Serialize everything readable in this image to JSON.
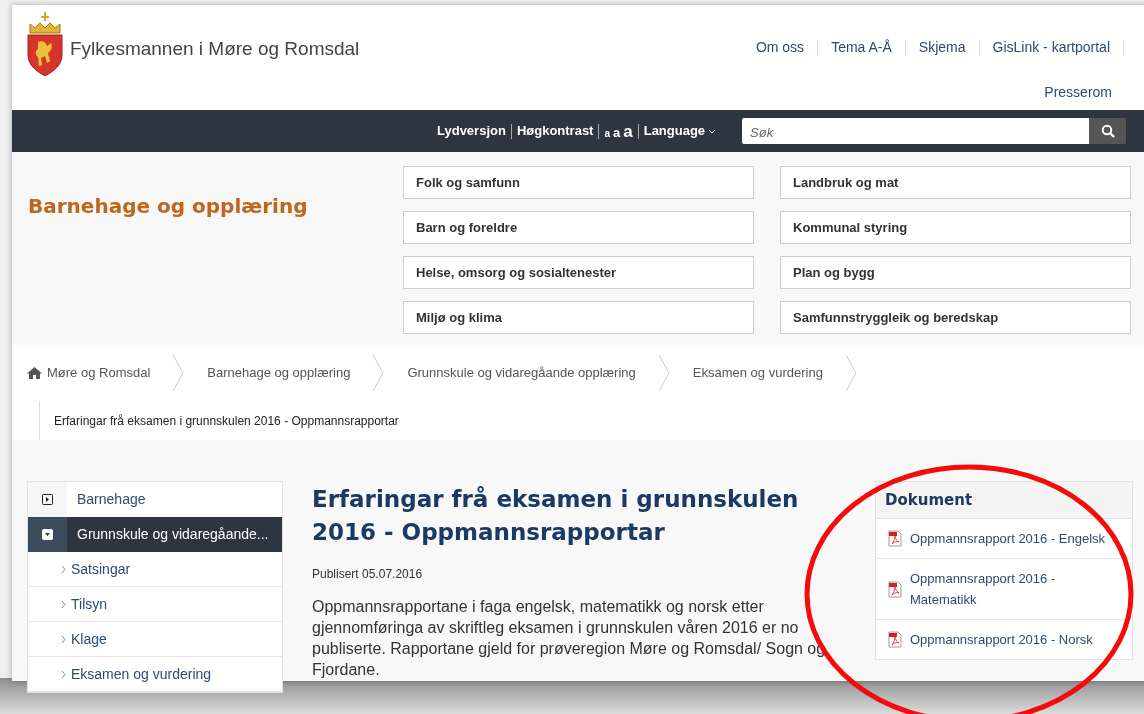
{
  "header": {
    "title": "Fylkesmannen i Møre og Romsdal",
    "top_links": [
      "Om oss",
      "Tema A-Å",
      "Skjema",
      "GisLink - kartportal"
    ],
    "second_link": "Presserom"
  },
  "toolbar": {
    "links": [
      "Lydversjon",
      "Høgkontrast"
    ],
    "text_sizes": [
      "a",
      "a",
      "a"
    ],
    "language": "Language",
    "search": {
      "placeholder": "Søk"
    }
  },
  "section_title": "Barnehage og opplæring",
  "categories": [
    "Folk og samfunn",
    "Landbruk og mat",
    "Barn og foreldre",
    "Kommunal styring",
    "Helse, omsorg og sosialtenester",
    "Plan og bygg",
    "Miljø og klima",
    "Samfunnstryggleik og beredskap"
  ],
  "breadcrumb": [
    "Møre og Romsdal",
    "Barnehage og opplæring",
    "Grunnskule og vidaregåande opplæring",
    "Eksamen og vurdering"
  ],
  "current_page": "Erfaringar frå eksamen i grunnskulen 2016 - Oppmannsrapportar",
  "sidebar": {
    "items": [
      {
        "label": "Barnehage",
        "expanded": false,
        "selected": false
      },
      {
        "label": "Grunnskule og vidaregåande...",
        "expanded": true,
        "selected": true,
        "children": [
          {
            "label": "Satsingar"
          },
          {
            "label": "Tilsyn"
          },
          {
            "label": "Klage"
          },
          {
            "label": "Eksamen og vurdering"
          }
        ]
      }
    ]
  },
  "article": {
    "title": "Erfaringar frå eksamen i grunnskulen 2016 - Oppmannsrapportar",
    "published": "Publisert 05.07.2016",
    "body": "Oppmannsrapportane i faga engelsk, matematikk og norsk etter gjennomføringa av skriftleg eksamen i grunnskulen våren 2016 er no publiserte. Rapportane gjeld for prøveregion Møre og Romsdal/ Sogn og Fjordane."
  },
  "documents": {
    "title": "Dokument",
    "items": [
      "Oppmannsrapport 2016 - Engelsk",
      "Oppmannsrapport 2016 - Matematikk",
      "Oppmannsrapport 2016 - Norsk"
    ]
  }
}
